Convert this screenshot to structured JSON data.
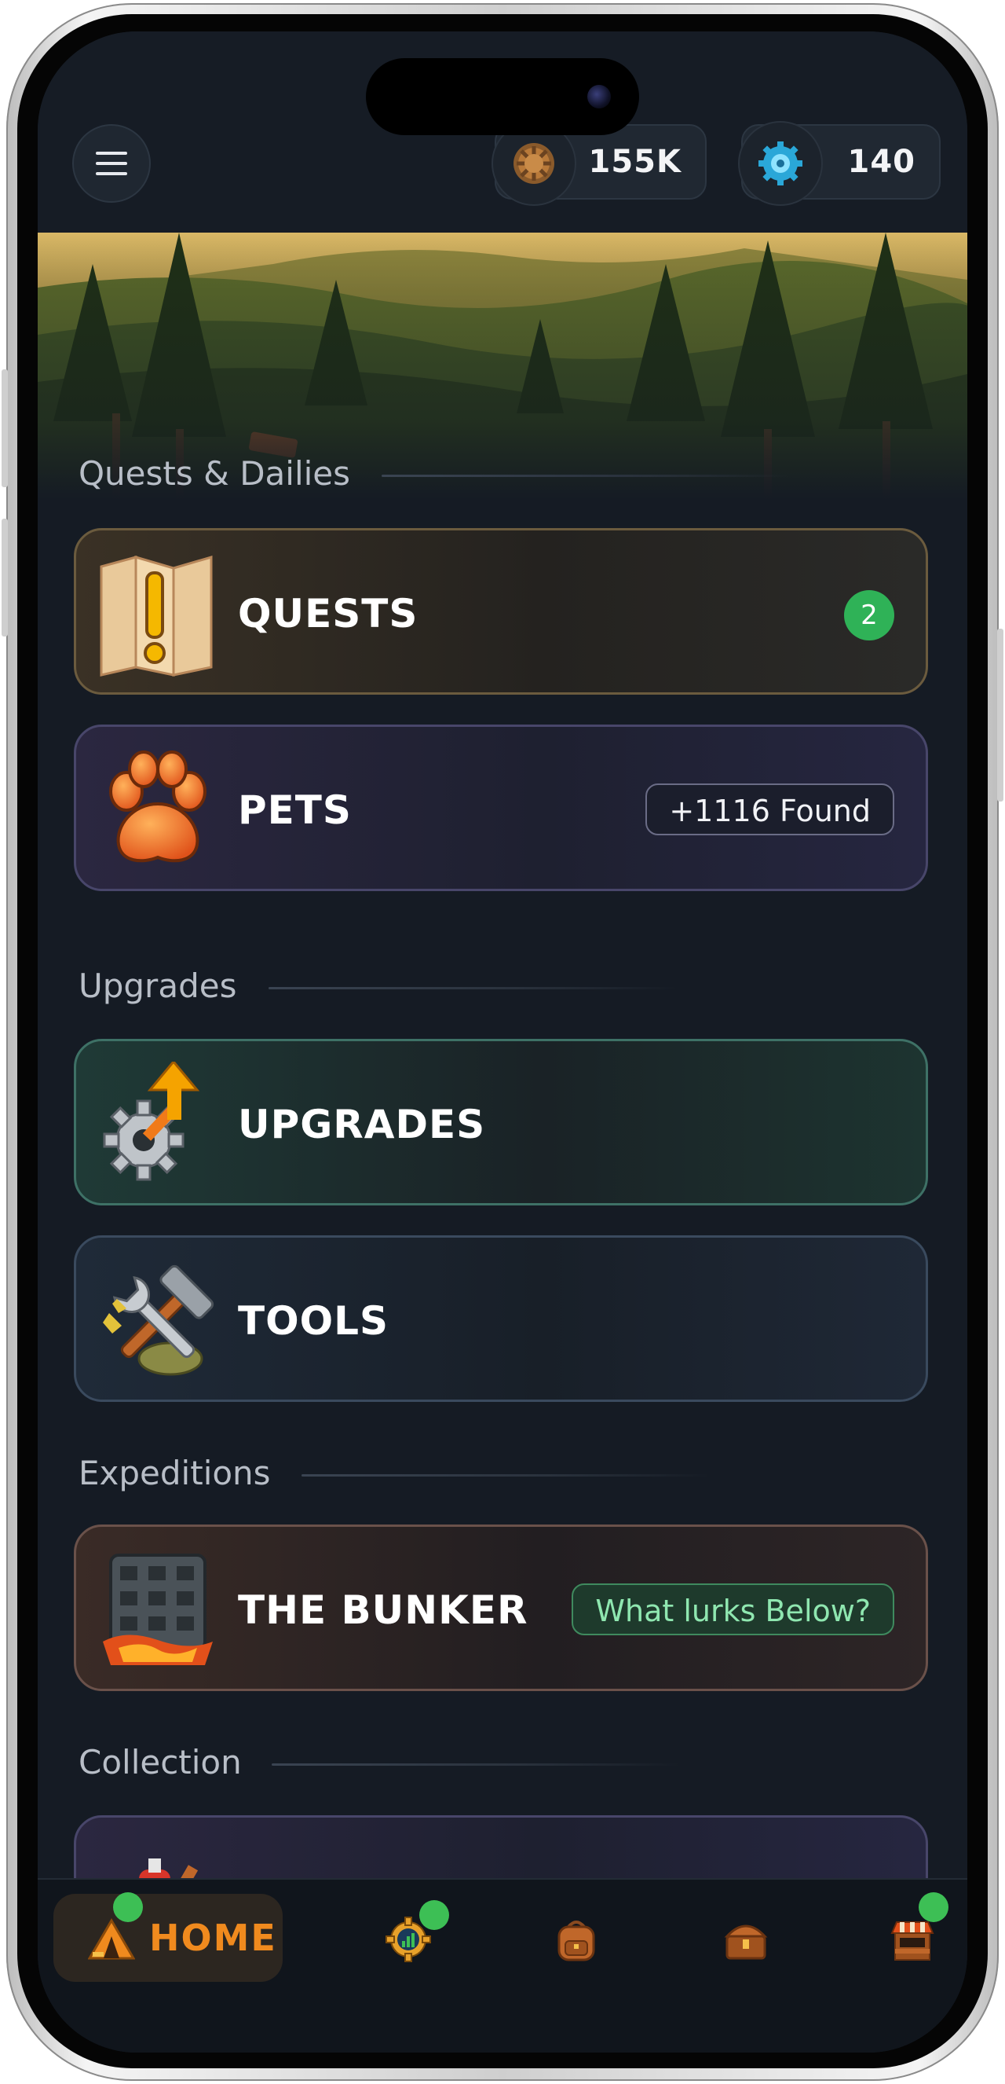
{
  "header": {
    "menu_icon": "hamburger-menu-icon",
    "currencies": [
      {
        "icon": "bronze-gear-coin-icon",
        "amount": "155K"
      },
      {
        "icon": "blue-gem-gear-icon",
        "amount": "140"
      }
    ]
  },
  "sections": {
    "quests_dailies": "Quests & Dailies",
    "upgrades": "Upgrades",
    "expeditions": "Expeditions",
    "collection": "Collection"
  },
  "cards": {
    "quests": {
      "label": "QUESTS",
      "icon": "quest-map-icon",
      "badge": "2"
    },
    "pets": {
      "label": "PETS",
      "icon": "paw-icon",
      "badge": "+1116 Found"
    },
    "upgrades": {
      "label": "UPGRADES",
      "icon": "gear-upgrade-arrow-icon"
    },
    "tools": {
      "label": "TOOLS",
      "icon": "hammer-wrench-tools-icon"
    },
    "bunker": {
      "label": "THE BUNKER",
      "icon": "bunker-icon",
      "badge": "What lurks Below?"
    }
  },
  "bottom_nav": {
    "home_label": "HOME",
    "items": [
      {
        "icon": "camp-tent-icon"
      },
      {
        "icon": "stats-gear-icon"
      },
      {
        "icon": "backpack-icon"
      },
      {
        "icon": "treasure-chest-icon"
      },
      {
        "icon": "shop-stall-icon"
      }
    ]
  },
  "colors": {
    "accent_orange": "#f08a1e",
    "notification_green": "#3dbf55",
    "background": "#151b24"
  }
}
